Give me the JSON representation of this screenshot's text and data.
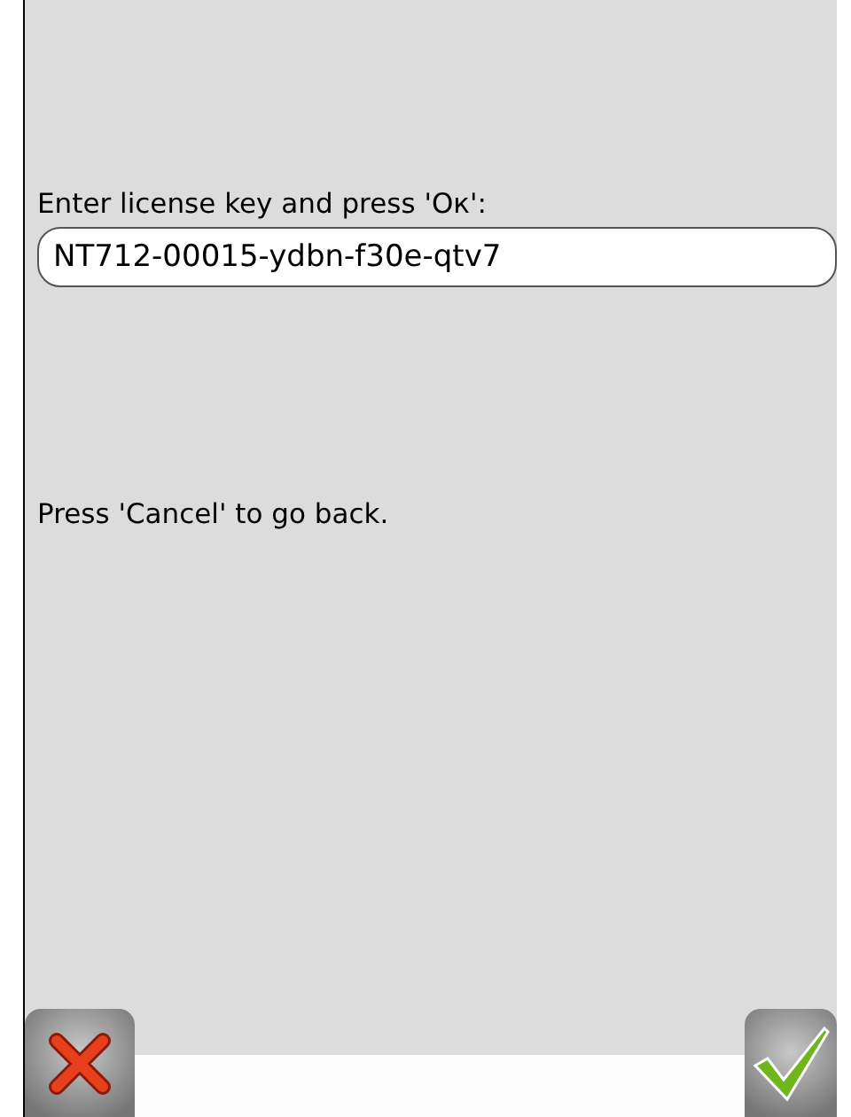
{
  "prompt": "Enter license key and press 'Oк':",
  "license_key": {
    "value": "NT712-00015-ydbn-f30e-qtv7"
  },
  "hint": "Press 'Cancel' to go back."
}
